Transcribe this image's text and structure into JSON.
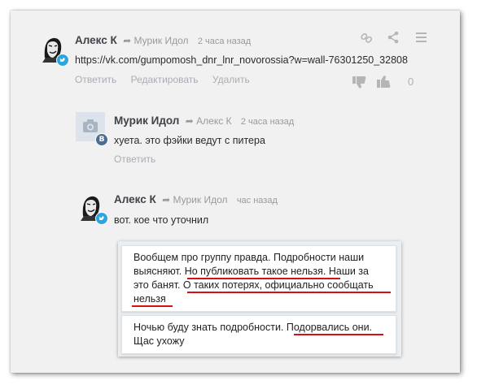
{
  "top_comment": {
    "author": "Алекс К",
    "reply_to": "Мурик Идол",
    "time": "2 часа назад",
    "text": "https://vk.com/gumpomosh_dnr_lnr_novorossia?w=wall-76301250_32808",
    "actions": [
      "Ответить",
      "Редактировать",
      "Удалить"
    ],
    "vote_count": "0",
    "badge_icon": "twitter-icon"
  },
  "reply1": {
    "author": "Мурик Идол",
    "reply_to": "Алекс К",
    "time": "2 часа назад",
    "text": "хуета. это фэйки ведут с питера",
    "action": "Ответить",
    "badge_letter": "B",
    "badge_icon": "vk-icon"
  },
  "reply2": {
    "author": "Алекс К",
    "reply_to": "Мурик Идол",
    "time": "час назад",
    "text": "вот. кое что уточнил",
    "badge_icon": "twitter-icon"
  },
  "screenshot": {
    "bubble1": [
      "Вообщем про группу правда. Подробности наши",
      "выясняют. Но публиковать такое нельзя. Наши за",
      "это банят. О таких потерях, официально сообщать",
      "нельзя"
    ],
    "bubble2": [
      "Ночью буду знать подробности. Подорвались они.",
      "Щас ухожу"
    ]
  },
  "colors": {
    "background": "#f1f1f1",
    "author": "#3f4247",
    "meta": "#9a9a9a",
    "link": "#a9adb3",
    "underline": "#d41010",
    "twitter": "#2ba6de",
    "vk": "#4c6c91"
  }
}
